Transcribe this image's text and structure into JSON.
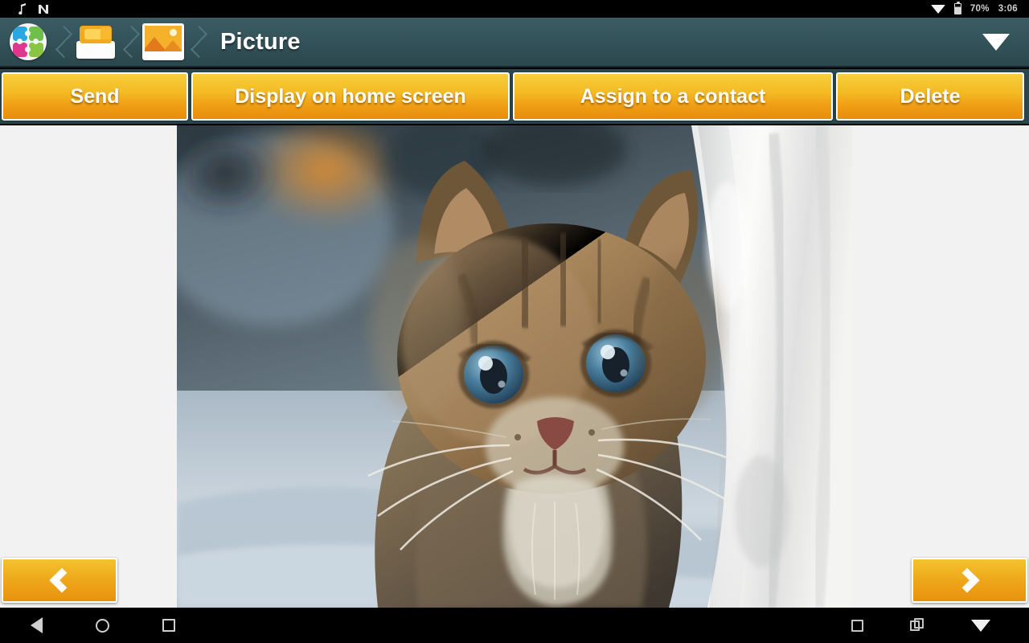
{
  "status_bar": {
    "left_icons": [
      "music-note-icon",
      "nfc-icon"
    ],
    "wifi_icon": "wifi-icon",
    "battery_icon": "battery-icon",
    "battery_percent": "70%",
    "clock": "3:06"
  },
  "header": {
    "breadcrumb": [
      {
        "icon": "app-puzzle-icon",
        "name": "app-home"
      },
      {
        "icon": "file-box-icon",
        "name": "files"
      },
      {
        "icon": "picture-icon",
        "name": "pictures"
      }
    ],
    "title": "Picture",
    "right_icon": "wifi-icon"
  },
  "toolbar": {
    "buttons": [
      {
        "label": "Send",
        "name": "send-button"
      },
      {
        "label": "Display on home screen",
        "name": "display-on-home-screen-button"
      },
      {
        "label": "Assign to a contact",
        "name": "assign-to-a-contact-button"
      },
      {
        "label": "Delete",
        "name": "delete-button"
      }
    ]
  },
  "viewer": {
    "image_alt": "Tabby kitten with blue eyes beside a white towel",
    "prev_label": "‹",
    "next_label": "›",
    "background_color": "#f2f2f2"
  },
  "navigation_bar": {
    "back": "back-icon",
    "home": "home-icon",
    "recents": "recents-icon",
    "screenshot": "screenshot-icon",
    "copy": "copy-icon",
    "wifi": "wifi-icon"
  },
  "colors": {
    "header": "#34535a",
    "accent_orange": "#efa81a",
    "button_text": "#ffffff",
    "status_bar": "#000000"
  }
}
